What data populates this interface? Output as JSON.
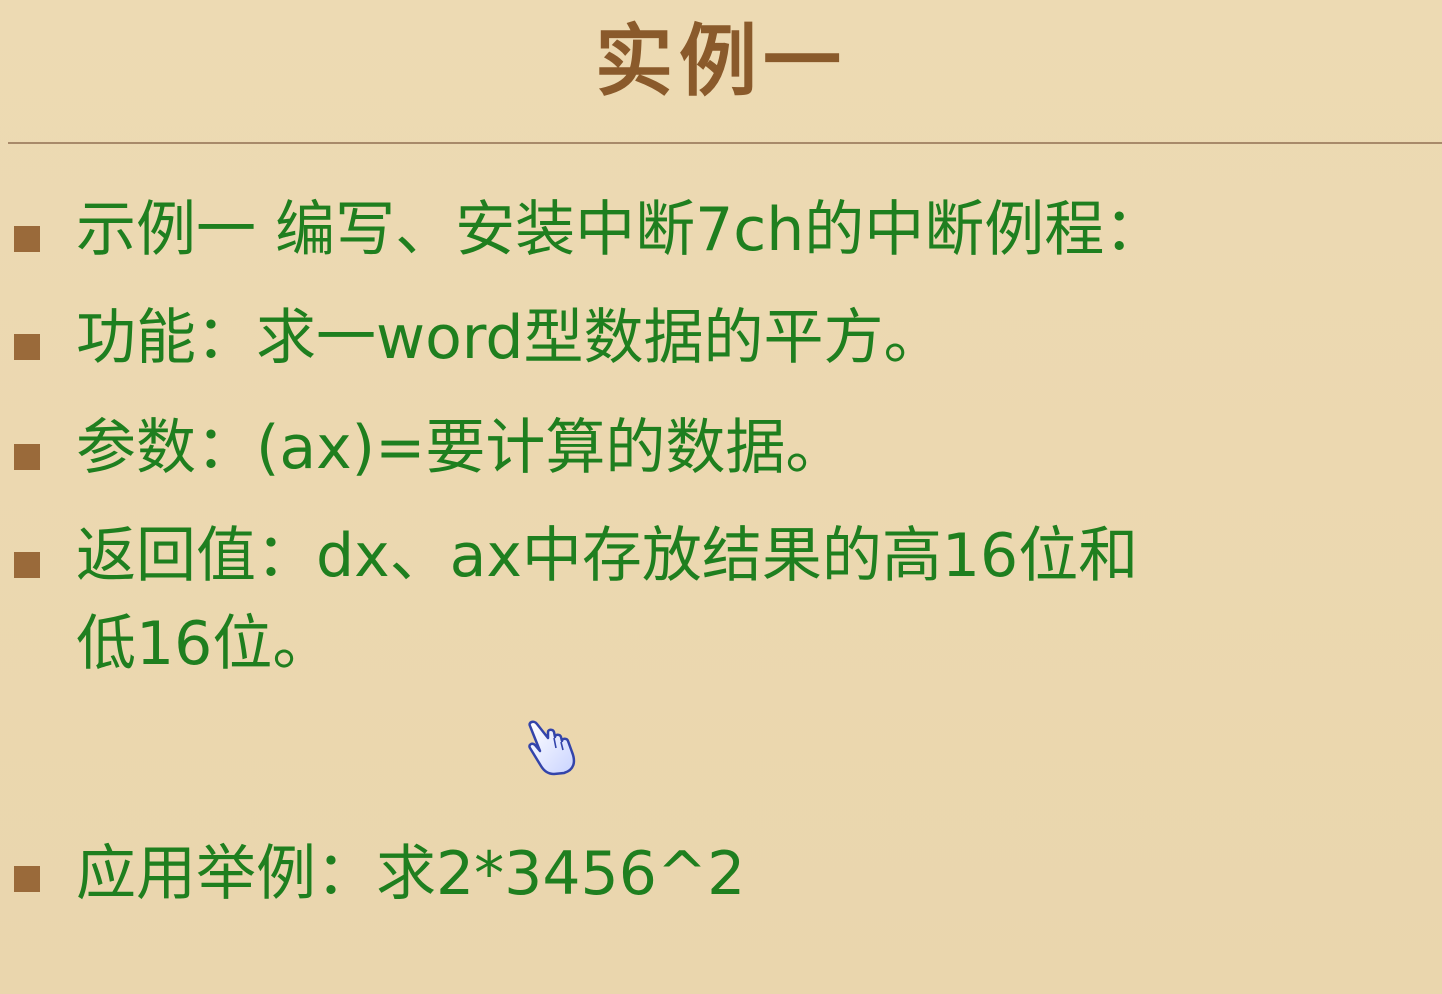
{
  "slide": {
    "title": "实例一",
    "bullets": [
      "示例一 编写、安装中断7ch的中断例程：",
      "功能：求一word型数据的平方。",
      "参数：(ax)=要计算的数据。",
      "返回值：dx、ax中存放结果的高16位和",
      "应用举例：求2*3456^2"
    ],
    "continuation": "低16位。"
  },
  "colors": {
    "background": "#ecd8b0",
    "title": "#8a5a2b",
    "text": "#1f7f1f",
    "bullet": "#9a6a3a",
    "rule": "#a88a6a"
  },
  "icons": {
    "cursor": "hand-pointer-icon",
    "bullet": "square-bullet-icon"
  }
}
